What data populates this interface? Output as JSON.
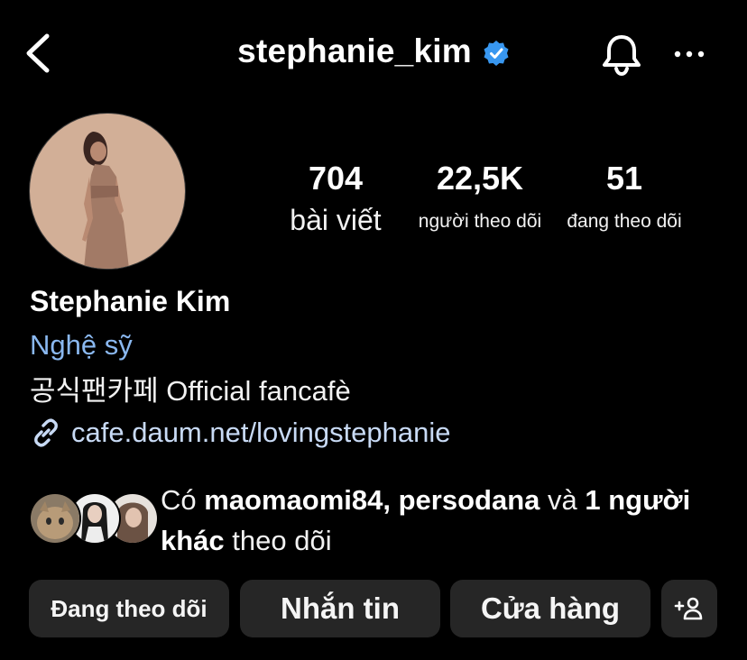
{
  "header": {
    "username": "stephanie_kim",
    "back_icon": "chevron-left-icon",
    "verified_icon": "verified-badge-icon",
    "bell_icon": "bell-icon",
    "more_icon": "more-horizontal-icon"
  },
  "profile": {
    "stats": {
      "posts_count": "704",
      "posts_label": "bài viết",
      "followers_count": "22,5K",
      "followers_label": "người theo dõi",
      "following_count": "51",
      "following_label": "đang theo dõi"
    },
    "display_name": "Stephanie Kim",
    "category": "Nghệ sỹ",
    "bio": "공식팬카페 Official fancafè",
    "link": "cafe.daum.net/lovingstephanie",
    "link_icon": "link-icon"
  },
  "followed_by": {
    "prefix": "Có ",
    "users": "maomaomi84, persodana",
    "connector": " và ",
    "others": "1 người khác",
    "suffix": " theo dõi"
  },
  "actions": {
    "following_label": "Đang theo dõi",
    "message_label": "Nhắn tin",
    "shop_label": "Cửa hàng",
    "add_user_icon": "add-person-icon"
  },
  "colors": {
    "background": "#000000",
    "button_bg": "#262626",
    "category_text": "#8ab8f0",
    "link_text": "#c8daf5",
    "verified_blue": "#3897f0"
  }
}
